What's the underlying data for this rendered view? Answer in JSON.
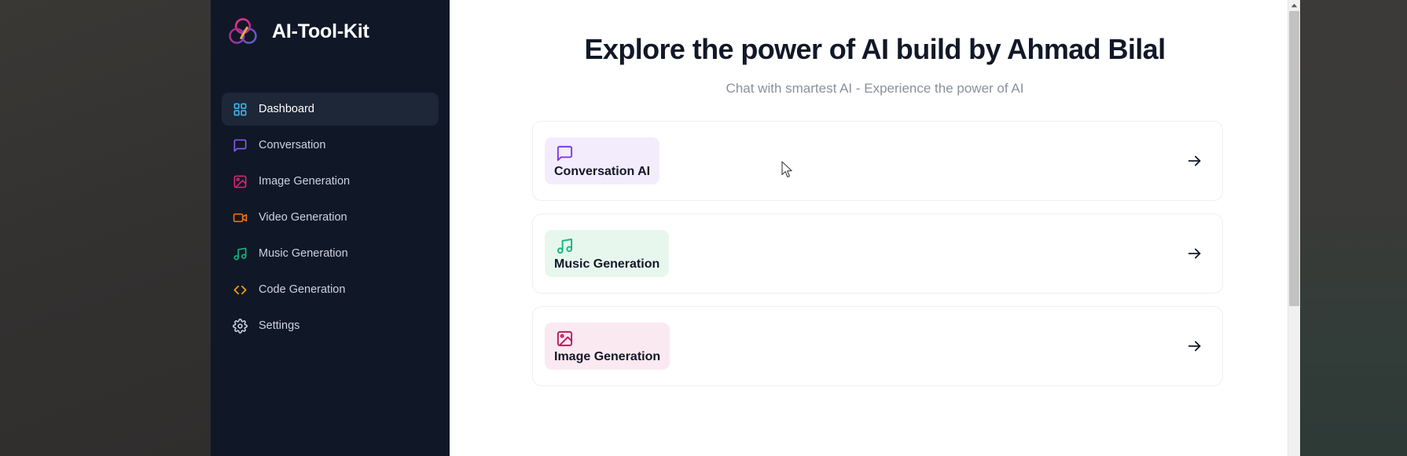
{
  "app": {
    "name": "AI-Tool-Kit",
    "logo_icon": "three-circles-logo-icon"
  },
  "sidebar": {
    "items": [
      {
        "label": "Dashboard",
        "icon": "layout-grid-icon",
        "color": "#38bdf8",
        "active": true
      },
      {
        "label": "Conversation",
        "icon": "message-square-icon",
        "color": "#8b5cf6",
        "active": false
      },
      {
        "label": "Image Generation",
        "icon": "image-icon",
        "color": "#db2777",
        "active": false
      },
      {
        "label": "Video Generation",
        "icon": "video-icon",
        "color": "#f97316",
        "active": false
      },
      {
        "label": "Music Generation",
        "icon": "music-icon",
        "color": "#10b981",
        "active": false
      },
      {
        "label": "Code Generation",
        "icon": "code-icon",
        "color": "#f59e0b",
        "active": false
      },
      {
        "label": "Settings",
        "icon": "gear-icon",
        "color": "#cbd3e1",
        "active": false
      }
    ]
  },
  "main": {
    "title": "Explore the power of AI build by Ahmad Bilal",
    "subtitle": "Chat with smartest AI - Experience the power of AI",
    "cards": [
      {
        "label": "Conversation AI",
        "icon": "message-square-icon",
        "icon_color": "#7c3aed",
        "badge_bg": "#f3ecfd",
        "arrow_icon": "arrow-right-icon"
      },
      {
        "label": "Music Generation",
        "icon": "music-icon",
        "icon_color": "#10b981",
        "badge_bg": "#e8f7ee",
        "arrow_icon": "arrow-right-icon"
      },
      {
        "label": "Image Generation",
        "icon": "image-icon",
        "icon_color": "#be185d",
        "badge_bg": "#fbe9f1",
        "arrow_icon": "arrow-right-icon"
      }
    ]
  },
  "scrollbar": {
    "up_arrow_icon": "scroll-up-arrow-icon",
    "thumb_label": "vertical-scroll-thumb"
  },
  "colors": {
    "sidebar_bg": "#101827",
    "sidebar_active_bg": "#1d2738",
    "page_bg": "#ffffff",
    "title_color": "#111827",
    "subtitle_color": "#8a909c",
    "card_border": "#f0f0f2"
  }
}
